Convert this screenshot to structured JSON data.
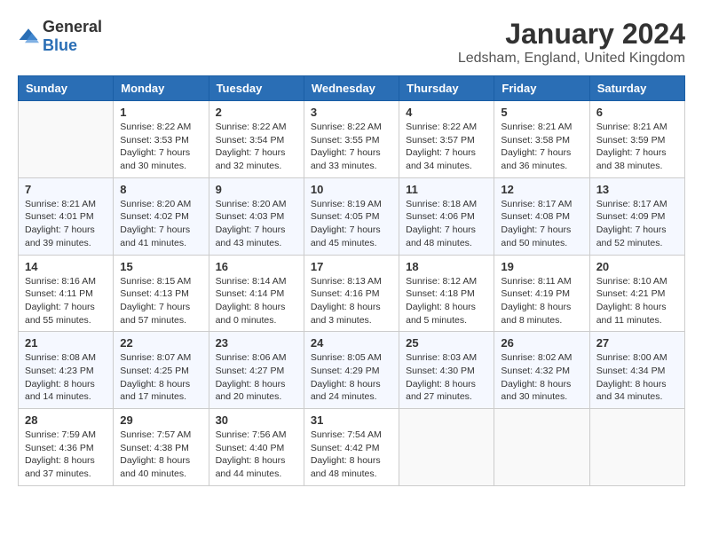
{
  "logo": {
    "general": "General",
    "blue": "Blue"
  },
  "header": {
    "title": "January 2024",
    "subtitle": "Ledsham, England, United Kingdom"
  },
  "weekdays": [
    "Sunday",
    "Monday",
    "Tuesday",
    "Wednesday",
    "Thursday",
    "Friday",
    "Saturday"
  ],
  "weeks": [
    [
      {
        "day": "",
        "sunrise": "",
        "sunset": "",
        "daylight": ""
      },
      {
        "day": "1",
        "sunrise": "Sunrise: 8:22 AM",
        "sunset": "Sunset: 3:53 PM",
        "daylight": "Daylight: 7 hours and 30 minutes."
      },
      {
        "day": "2",
        "sunrise": "Sunrise: 8:22 AM",
        "sunset": "Sunset: 3:54 PM",
        "daylight": "Daylight: 7 hours and 32 minutes."
      },
      {
        "day": "3",
        "sunrise": "Sunrise: 8:22 AM",
        "sunset": "Sunset: 3:55 PM",
        "daylight": "Daylight: 7 hours and 33 minutes."
      },
      {
        "day": "4",
        "sunrise": "Sunrise: 8:22 AM",
        "sunset": "Sunset: 3:57 PM",
        "daylight": "Daylight: 7 hours and 34 minutes."
      },
      {
        "day": "5",
        "sunrise": "Sunrise: 8:21 AM",
        "sunset": "Sunset: 3:58 PM",
        "daylight": "Daylight: 7 hours and 36 minutes."
      },
      {
        "day": "6",
        "sunrise": "Sunrise: 8:21 AM",
        "sunset": "Sunset: 3:59 PM",
        "daylight": "Daylight: 7 hours and 38 minutes."
      }
    ],
    [
      {
        "day": "7",
        "sunrise": "Sunrise: 8:21 AM",
        "sunset": "Sunset: 4:01 PM",
        "daylight": "Daylight: 7 hours and 39 minutes."
      },
      {
        "day": "8",
        "sunrise": "Sunrise: 8:20 AM",
        "sunset": "Sunset: 4:02 PM",
        "daylight": "Daylight: 7 hours and 41 minutes."
      },
      {
        "day": "9",
        "sunrise": "Sunrise: 8:20 AM",
        "sunset": "Sunset: 4:03 PM",
        "daylight": "Daylight: 7 hours and 43 minutes."
      },
      {
        "day": "10",
        "sunrise": "Sunrise: 8:19 AM",
        "sunset": "Sunset: 4:05 PM",
        "daylight": "Daylight: 7 hours and 45 minutes."
      },
      {
        "day": "11",
        "sunrise": "Sunrise: 8:18 AM",
        "sunset": "Sunset: 4:06 PM",
        "daylight": "Daylight: 7 hours and 48 minutes."
      },
      {
        "day": "12",
        "sunrise": "Sunrise: 8:17 AM",
        "sunset": "Sunset: 4:08 PM",
        "daylight": "Daylight: 7 hours and 50 minutes."
      },
      {
        "day": "13",
        "sunrise": "Sunrise: 8:17 AM",
        "sunset": "Sunset: 4:09 PM",
        "daylight": "Daylight: 7 hours and 52 minutes."
      }
    ],
    [
      {
        "day": "14",
        "sunrise": "Sunrise: 8:16 AM",
        "sunset": "Sunset: 4:11 PM",
        "daylight": "Daylight: 7 hours and 55 minutes."
      },
      {
        "day": "15",
        "sunrise": "Sunrise: 8:15 AM",
        "sunset": "Sunset: 4:13 PM",
        "daylight": "Daylight: 7 hours and 57 minutes."
      },
      {
        "day": "16",
        "sunrise": "Sunrise: 8:14 AM",
        "sunset": "Sunset: 4:14 PM",
        "daylight": "Daylight: 8 hours and 0 minutes."
      },
      {
        "day": "17",
        "sunrise": "Sunrise: 8:13 AM",
        "sunset": "Sunset: 4:16 PM",
        "daylight": "Daylight: 8 hours and 3 minutes."
      },
      {
        "day": "18",
        "sunrise": "Sunrise: 8:12 AM",
        "sunset": "Sunset: 4:18 PM",
        "daylight": "Daylight: 8 hours and 5 minutes."
      },
      {
        "day": "19",
        "sunrise": "Sunrise: 8:11 AM",
        "sunset": "Sunset: 4:19 PM",
        "daylight": "Daylight: 8 hours and 8 minutes."
      },
      {
        "day": "20",
        "sunrise": "Sunrise: 8:10 AM",
        "sunset": "Sunset: 4:21 PM",
        "daylight": "Daylight: 8 hours and 11 minutes."
      }
    ],
    [
      {
        "day": "21",
        "sunrise": "Sunrise: 8:08 AM",
        "sunset": "Sunset: 4:23 PM",
        "daylight": "Daylight: 8 hours and 14 minutes."
      },
      {
        "day": "22",
        "sunrise": "Sunrise: 8:07 AM",
        "sunset": "Sunset: 4:25 PM",
        "daylight": "Daylight: 8 hours and 17 minutes."
      },
      {
        "day": "23",
        "sunrise": "Sunrise: 8:06 AM",
        "sunset": "Sunset: 4:27 PM",
        "daylight": "Daylight: 8 hours and 20 minutes."
      },
      {
        "day": "24",
        "sunrise": "Sunrise: 8:05 AM",
        "sunset": "Sunset: 4:29 PM",
        "daylight": "Daylight: 8 hours and 24 minutes."
      },
      {
        "day": "25",
        "sunrise": "Sunrise: 8:03 AM",
        "sunset": "Sunset: 4:30 PM",
        "daylight": "Daylight: 8 hours and 27 minutes."
      },
      {
        "day": "26",
        "sunrise": "Sunrise: 8:02 AM",
        "sunset": "Sunset: 4:32 PM",
        "daylight": "Daylight: 8 hours and 30 minutes."
      },
      {
        "day": "27",
        "sunrise": "Sunrise: 8:00 AM",
        "sunset": "Sunset: 4:34 PM",
        "daylight": "Daylight: 8 hours and 34 minutes."
      }
    ],
    [
      {
        "day": "28",
        "sunrise": "Sunrise: 7:59 AM",
        "sunset": "Sunset: 4:36 PM",
        "daylight": "Daylight: 8 hours and 37 minutes."
      },
      {
        "day": "29",
        "sunrise": "Sunrise: 7:57 AM",
        "sunset": "Sunset: 4:38 PM",
        "daylight": "Daylight: 8 hours and 40 minutes."
      },
      {
        "day": "30",
        "sunrise": "Sunrise: 7:56 AM",
        "sunset": "Sunset: 4:40 PM",
        "daylight": "Daylight: 8 hours and 44 minutes."
      },
      {
        "day": "31",
        "sunrise": "Sunrise: 7:54 AM",
        "sunset": "Sunset: 4:42 PM",
        "daylight": "Daylight: 8 hours and 48 minutes."
      },
      {
        "day": "",
        "sunrise": "",
        "sunset": "",
        "daylight": ""
      },
      {
        "day": "",
        "sunrise": "",
        "sunset": "",
        "daylight": ""
      },
      {
        "day": "",
        "sunrise": "",
        "sunset": "",
        "daylight": ""
      }
    ]
  ]
}
